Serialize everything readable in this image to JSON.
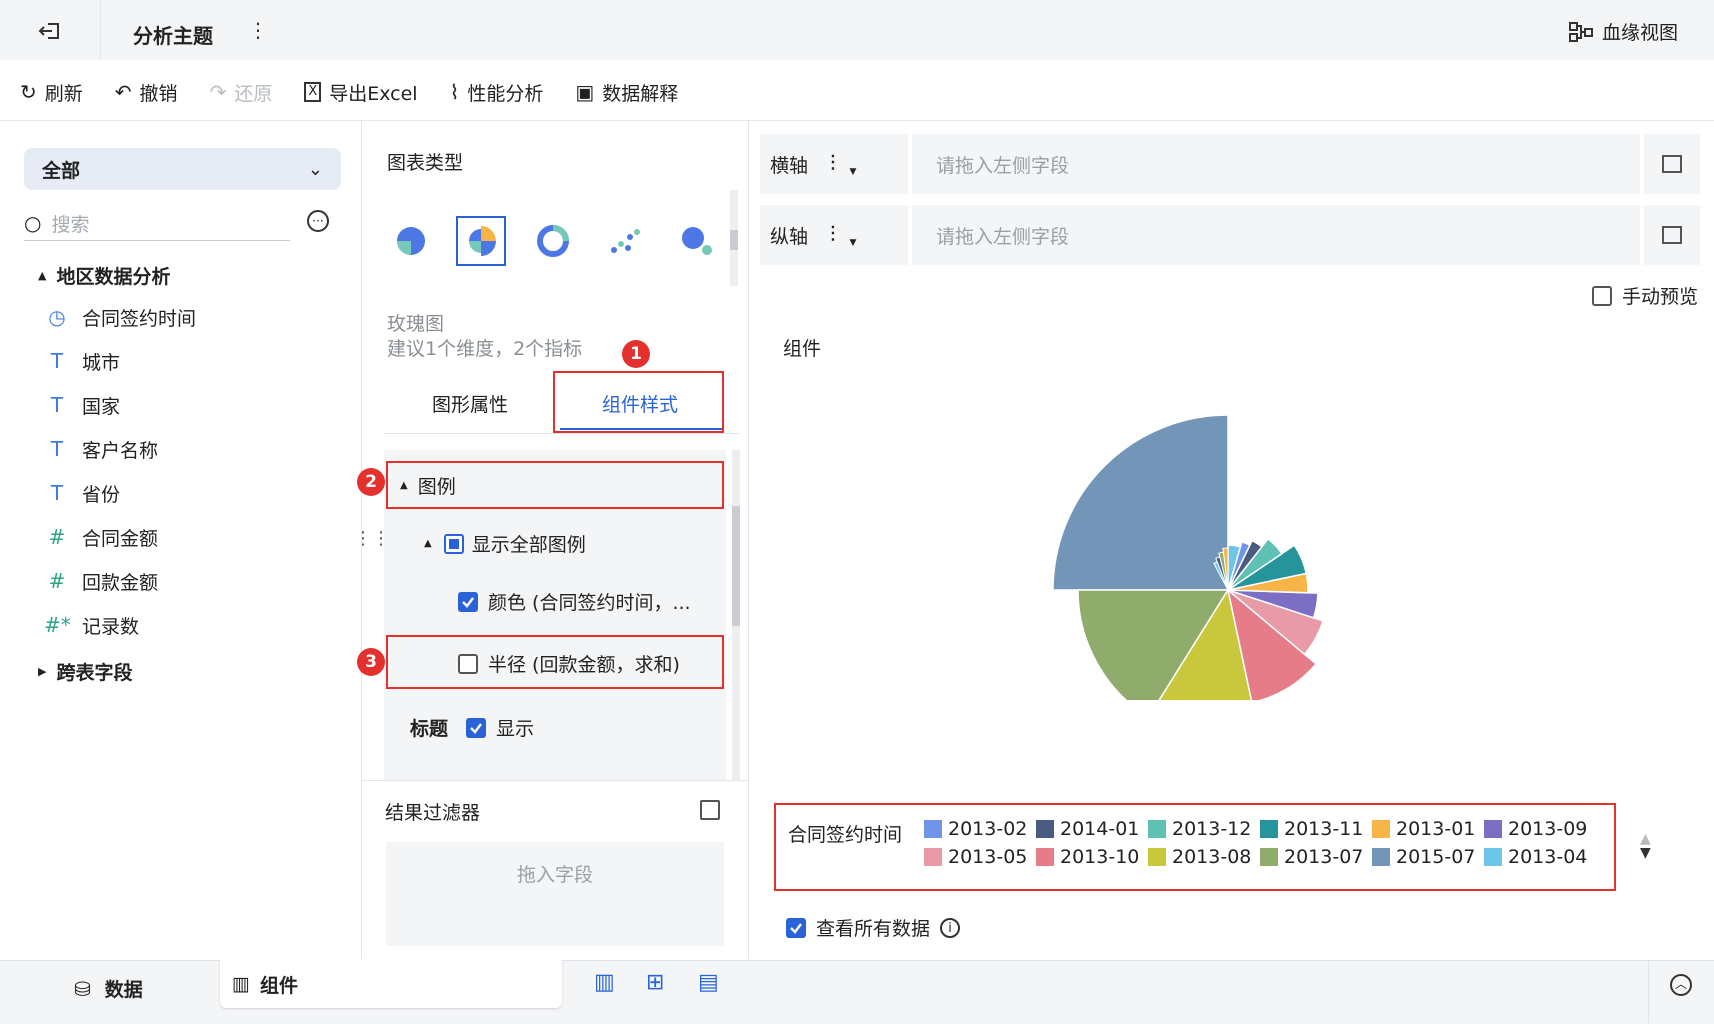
{
  "header": {
    "title": "分析主题",
    "lineage_label": "血缘视图"
  },
  "toolbar": {
    "refresh": "刷新",
    "undo": "撤销",
    "redo": "还原",
    "export": "导出Excel",
    "perf": "性能分析",
    "explain": "数据解释"
  },
  "left_panel": {
    "dropdown_value": "全部",
    "search_placeholder": "搜索",
    "group1": "地区数据分析",
    "fields": [
      {
        "icon": "clock-icon",
        "label": "合同签约时间"
      },
      {
        "icon": "text-icon",
        "label": "城市"
      },
      {
        "icon": "text-icon",
        "label": "国家"
      },
      {
        "icon": "text-icon",
        "label": "客户名称"
      },
      {
        "icon": "text-icon",
        "label": "省份"
      },
      {
        "icon": "number-icon",
        "label": "合同金额"
      },
      {
        "icon": "number-icon",
        "label": "回款金额"
      },
      {
        "icon": "number-star-icon",
        "label": "记录数"
      }
    ],
    "group2": "跨表字段"
  },
  "middle_panel": {
    "chart_type_title": "图表类型",
    "chart_name": "玫瑰图",
    "chart_hint": "建议1个维度，2个指标",
    "tab_graph": "图形属性",
    "tab_component": "组件样式",
    "legend_section": "图例",
    "show_all_legend": "显示全部图例",
    "color_item": "颜色 (合同签约时间，...",
    "radius_item": "半径 (回款金额，求和)",
    "title_label": "标题",
    "title_show": "显示",
    "result_filter": "结果过滤器",
    "drop_field": "拖入字段"
  },
  "annotations": [
    "1",
    "2",
    "3"
  ],
  "right_panel": {
    "x_axis_label": "横轴",
    "y_axis_label": "纵轴",
    "x_placeholder": "请拖入左侧字段",
    "y_placeholder": "请拖入左侧字段",
    "manual_preview": "手动预览",
    "component_title": "组件",
    "legend_title": "合同签约时间",
    "view_all_data": "查看所有数据"
  },
  "chart_data": {
    "type": "rose",
    "legend": [
      {
        "label": "2013-02",
        "color": "#6f94e8"
      },
      {
        "label": "2014-01",
        "color": "#495b7e"
      },
      {
        "label": "2013-12",
        "color": "#5fc1b4"
      },
      {
        "label": "2013-11",
        "color": "#26959b"
      },
      {
        "label": "2013-01",
        "color": "#f7b447"
      },
      {
        "label": "2013-09",
        "color": "#7b6fc4"
      },
      {
        "label": "2013-05",
        "color": "#e89aa8"
      },
      {
        "label": "2013-10",
        "color": "#e67c88"
      },
      {
        "label": "2013-08",
        "color": "#c9c83c"
      },
      {
        "label": "2013-07",
        "color": "#8fac6c"
      },
      {
        "label": "2015-07",
        "color": "#7395b8"
      },
      {
        "label": "2013-04",
        "color": "#6ec6e6"
      }
    ]
  },
  "bottom_bar": {
    "data_tab": "数据",
    "component_tab": "组件"
  }
}
